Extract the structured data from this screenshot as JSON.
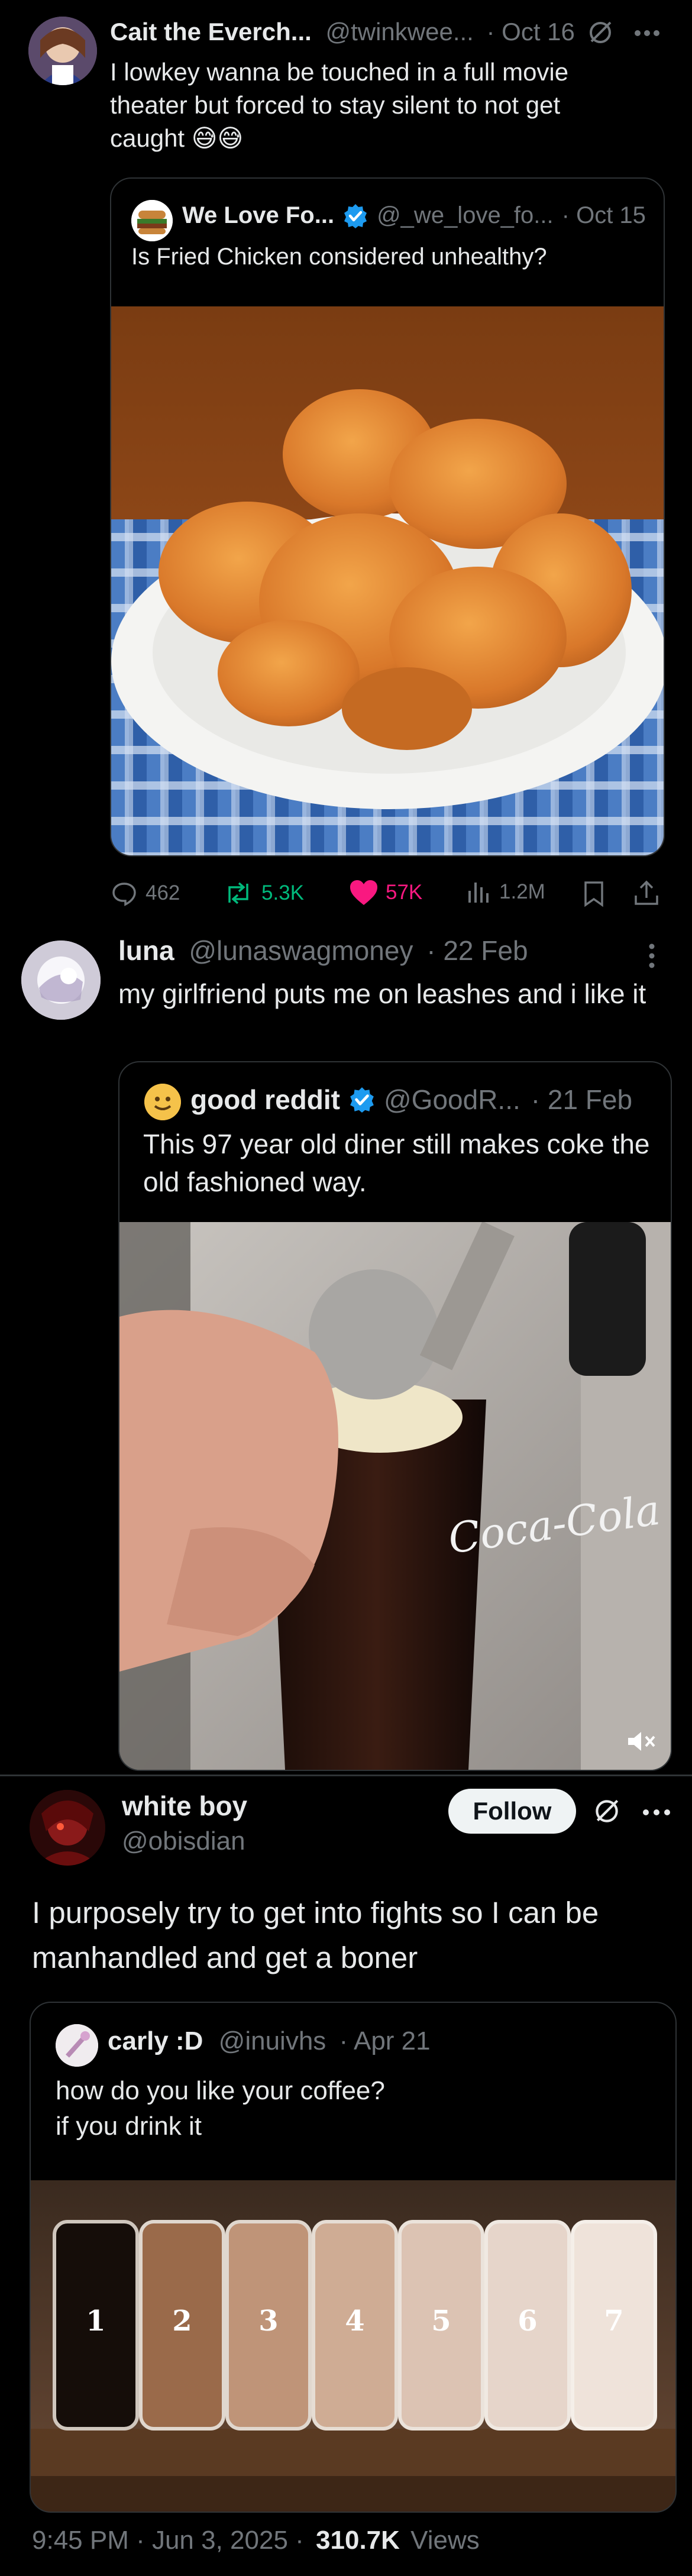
{
  "post1": {
    "author_name": "Cait the Everch...",
    "handle": "@twinkwee...",
    "date": "· Oct 16",
    "text": "I lowkey wanna be touched in a full movie theater but forced to stay silent to not get caught 😅😅",
    "quote": {
      "author_name": "We Love Fo...",
      "handle": "@_we_love_fo...",
      "date": "· Oct 15",
      "text": "Is Fried Chicken considered unhealthy?"
    },
    "stats": {
      "replies": "462",
      "reposts": "5.3K",
      "likes": "57K",
      "views": "1.2M"
    }
  },
  "post2": {
    "author_name": "luna",
    "handle": "@lunaswagmoney",
    "date": "· 22 Feb",
    "text": "my girlfriend puts me on leashes and i like it",
    "quote": {
      "author_name": "good reddit",
      "handle": "@GoodR...",
      "date": "· 21 Feb",
      "text": "This 97 year old diner still makes coke the old fashioned way."
    },
    "video_brand": "Coca-Cola"
  },
  "post3": {
    "author_name": "white boy",
    "handle": "@obisdian",
    "follow_label": "Follow",
    "text": "I purposely try to get into fights so I can be manhandled and get a boner",
    "quote": {
      "author_name": "carly :D",
      "handle": "@inuivhs",
      "date": "· Apr 21",
      "text_line1": "how do you like your coffee?",
      "text_line2": "if you drink it",
      "jar_labels": [
        "1",
        "2",
        "3",
        "4",
        "5",
        "6",
        "7"
      ]
    },
    "timestamp": "9:45 PM · Jun 3, 2025 ·",
    "views_count": "310.7K",
    "views_label": "Views"
  },
  "colors": {
    "background": "#000000",
    "text": "#e7e9ea",
    "muted": "#71767b",
    "verified": "#1d9bf0",
    "repost": "#00ba7c",
    "like": "#f91880",
    "border": "#2f3336"
  }
}
